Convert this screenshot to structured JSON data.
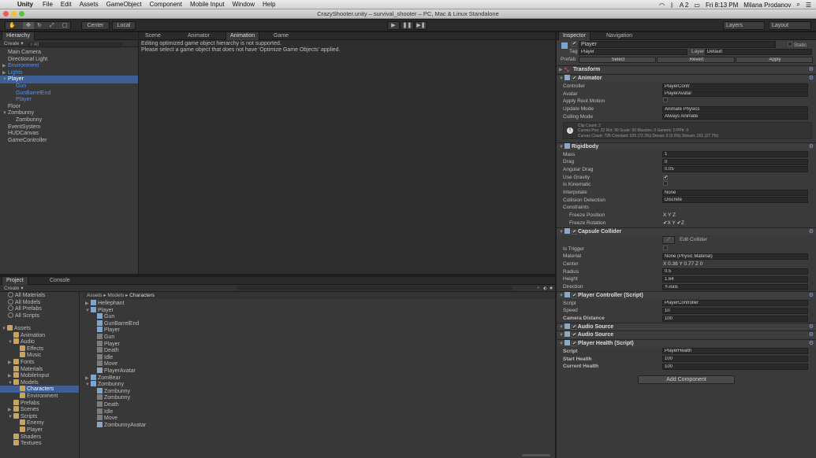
{
  "menubar": {
    "app": "Unity",
    "items": [
      "File",
      "Edit",
      "Assets",
      "GameObject",
      "Component",
      "Mobile Input",
      "Window",
      "Help"
    ],
    "status": [
      "A 2",
      "Fri 8:13 PM",
      "Milana Prodanov"
    ]
  },
  "window": {
    "title": "CrazyShooter.unity – survival_shooter – PC, Mac & Linux Standalone"
  },
  "toolbar": {
    "center": "Center",
    "local": "Local",
    "layers": "Layers",
    "layout": "Layout"
  },
  "hierarchy": {
    "tab": "Hierarchy",
    "create": "Create",
    "search": "All",
    "items": [
      {
        "label": "Main Camera",
        "indent": 0
      },
      {
        "label": "Directional Light",
        "indent": 0
      },
      {
        "label": "Environment",
        "indent": 0,
        "prefab": true,
        "fold": "▶"
      },
      {
        "label": "Lights",
        "indent": 0,
        "prefab": true,
        "fold": "▶"
      },
      {
        "label": "Player",
        "indent": 0,
        "prefab": true,
        "fold": "▼",
        "selected": true
      },
      {
        "label": "Gun",
        "indent": 1,
        "prefab": true
      },
      {
        "label": "GunBarrelEnd",
        "indent": 1,
        "prefab": true
      },
      {
        "label": "Player",
        "indent": 1,
        "prefab": true
      },
      {
        "label": "Floor",
        "indent": 0
      },
      {
        "label": "Zombunny",
        "indent": 0,
        "fold": "▼"
      },
      {
        "label": "Zombunny",
        "indent": 1
      },
      {
        "label": "EventSystem",
        "indent": 0
      },
      {
        "label": "HUDCanvas",
        "indent": 0
      },
      {
        "label": "GameController",
        "indent": 0
      }
    ]
  },
  "center": {
    "tabs": [
      "Scene",
      "Animator",
      "Animation",
      "Game"
    ],
    "message1": "Editing optimized game object hierarchy is not supported.",
    "message2": "Please select a game object that does not have 'Optimize Game Objects' applied."
  },
  "project": {
    "tabs": [
      "Project",
      "Console"
    ],
    "create": "Create",
    "favorites": [
      "All Materials",
      "All Models",
      "All Prefabs",
      "All Scripts"
    ],
    "tree": [
      {
        "label": "Assets",
        "indent": 0,
        "fold": "▼"
      },
      {
        "label": "Animation",
        "indent": 1
      },
      {
        "label": "Audio",
        "indent": 1,
        "fold": "▼"
      },
      {
        "label": "Effects",
        "indent": 2
      },
      {
        "label": "Music",
        "indent": 2
      },
      {
        "label": "Fonts",
        "indent": 1,
        "fold": "▶"
      },
      {
        "label": "Materials",
        "indent": 1
      },
      {
        "label": "MobileInput",
        "indent": 1,
        "fold": "▶"
      },
      {
        "label": "Models",
        "indent": 1,
        "fold": "▼"
      },
      {
        "label": "Characters",
        "indent": 2,
        "selected": true
      },
      {
        "label": "Environment",
        "indent": 2
      },
      {
        "label": "Prefabs",
        "indent": 1
      },
      {
        "label": "Scenes",
        "indent": 1,
        "fold": "▶"
      },
      {
        "label": "Scripts",
        "indent": 1,
        "fold": "▼"
      },
      {
        "label": "Enemy",
        "indent": 2
      },
      {
        "label": "Player",
        "indent": 2
      },
      {
        "label": "Shaders",
        "indent": 1
      },
      {
        "label": "Textures",
        "indent": 1
      }
    ],
    "breadcrumb": [
      "Assets",
      "Models",
      "Characters"
    ],
    "files": [
      {
        "label": "Hellephant",
        "indent": 0,
        "fold": "▶",
        "kind": "model"
      },
      {
        "label": "Player",
        "indent": 0,
        "fold": "▼",
        "kind": "model"
      },
      {
        "label": "Gun",
        "indent": 1,
        "kind": "cube"
      },
      {
        "label": "GunBarrelEnd",
        "indent": 1,
        "kind": "cube"
      },
      {
        "label": "Player",
        "indent": 1,
        "kind": "cube"
      },
      {
        "label": "Gun",
        "indent": 1,
        "kind": "mesh"
      },
      {
        "label": "Player",
        "indent": 1,
        "kind": "mesh"
      },
      {
        "label": "Death",
        "indent": 1,
        "kind": "anim"
      },
      {
        "label": "Idle",
        "indent": 1,
        "kind": "anim"
      },
      {
        "label": "Move",
        "indent": 1,
        "kind": "anim"
      },
      {
        "label": "PlayerAvatar",
        "indent": 1,
        "kind": "avatar"
      },
      {
        "label": "ZomBear",
        "indent": 0,
        "fold": "▶",
        "kind": "model"
      },
      {
        "label": "Zombunny",
        "indent": 0,
        "fold": "▼",
        "kind": "model"
      },
      {
        "label": "Zombunny",
        "indent": 1,
        "kind": "cube"
      },
      {
        "label": "Zombunny",
        "indent": 1,
        "kind": "mesh"
      },
      {
        "label": "Death",
        "indent": 1,
        "kind": "anim"
      },
      {
        "label": "Idle",
        "indent": 1,
        "kind": "anim"
      },
      {
        "label": "Move",
        "indent": 1,
        "kind": "anim"
      },
      {
        "label": "ZombunnyAvatar",
        "indent": 1,
        "kind": "avatar"
      }
    ]
  },
  "inspector": {
    "tabs": [
      "Inspector",
      "Navigation"
    ],
    "name": "Player",
    "static": "Static",
    "tag_label": "Tag",
    "tag": "Player",
    "layer_label": "Layer",
    "layer": "Default",
    "prefab_label": "Prefab",
    "prefab_buttons": [
      "Select",
      "Revert",
      "Apply"
    ],
    "transform": "Transform",
    "animator": {
      "title": "Animator",
      "rows": [
        {
          "label": "Controller",
          "value": "PlayerContr"
        },
        {
          "label": "Avatar",
          "value": "PlayerAvatar"
        },
        {
          "label": "Apply Root Motion",
          "value": ""
        },
        {
          "label": "Update Mode",
          "value": "Animate Physics"
        },
        {
          "label": "Culling Mode",
          "value": "Always Animate"
        }
      ],
      "info": [
        "Clip Count: 2",
        "Curves Pos: 32 Rot: 90 Scale: 90 Muscles: 0 Generic: 0 PPtr: 0",
        "Curves Count: 726 Constant: 525 (72.3%) Dense: 0 (0.0%) Stream: 201 (27.7%)"
      ]
    },
    "rigidbody": {
      "title": "Rigidbody",
      "rows": [
        {
          "label": "Mass",
          "value": "1"
        },
        {
          "label": "Drag",
          "value": "0"
        },
        {
          "label": "Angular Drag",
          "value": "0.05"
        },
        {
          "label": "Use Gravity",
          "value": "✔"
        },
        {
          "label": "Is Kinematic",
          "value": ""
        },
        {
          "label": "Interpolate",
          "value": "None"
        },
        {
          "label": "Collision Detection",
          "value": "Discrete"
        },
        {
          "label": "Constraints",
          "value": ""
        },
        {
          "label": "Freeze Position",
          "value": "X  Y  Z"
        },
        {
          "label": "Freeze Rotation",
          "value": "✔X  Y ✔Z"
        }
      ]
    },
    "capsule": {
      "title": "Capsule Collider",
      "edit": "Edit Collider",
      "rows": [
        {
          "label": "Is Trigger",
          "value": ""
        },
        {
          "label": "Material",
          "value": "None (Physic Material)"
        },
        {
          "label": "Center",
          "value": "X 0.38        Y 0.77        Z 0"
        },
        {
          "label": "Radius",
          "value": "0.5"
        },
        {
          "label": "Height",
          "value": "1.64"
        },
        {
          "label": "Direction",
          "value": "Y-Axis"
        }
      ]
    },
    "playercontroller": {
      "title": "Player Controller (Script)",
      "rows": [
        {
          "label": "Script",
          "value": "PlayerController"
        },
        {
          "label": "Speed",
          "value": "10"
        },
        {
          "label": "Camera Distance",
          "value": "100"
        }
      ]
    },
    "audio1": "Audio Source",
    "audio2": "Audio Source",
    "playerhealth": {
      "title": "Player Health (Script)",
      "rows": [
        {
          "label": "Script",
          "value": "PlayerHealth"
        },
        {
          "label": "Start Health",
          "value": "100"
        },
        {
          "label": "Current Health",
          "value": "100"
        }
      ]
    },
    "add_component": "Add Component"
  }
}
